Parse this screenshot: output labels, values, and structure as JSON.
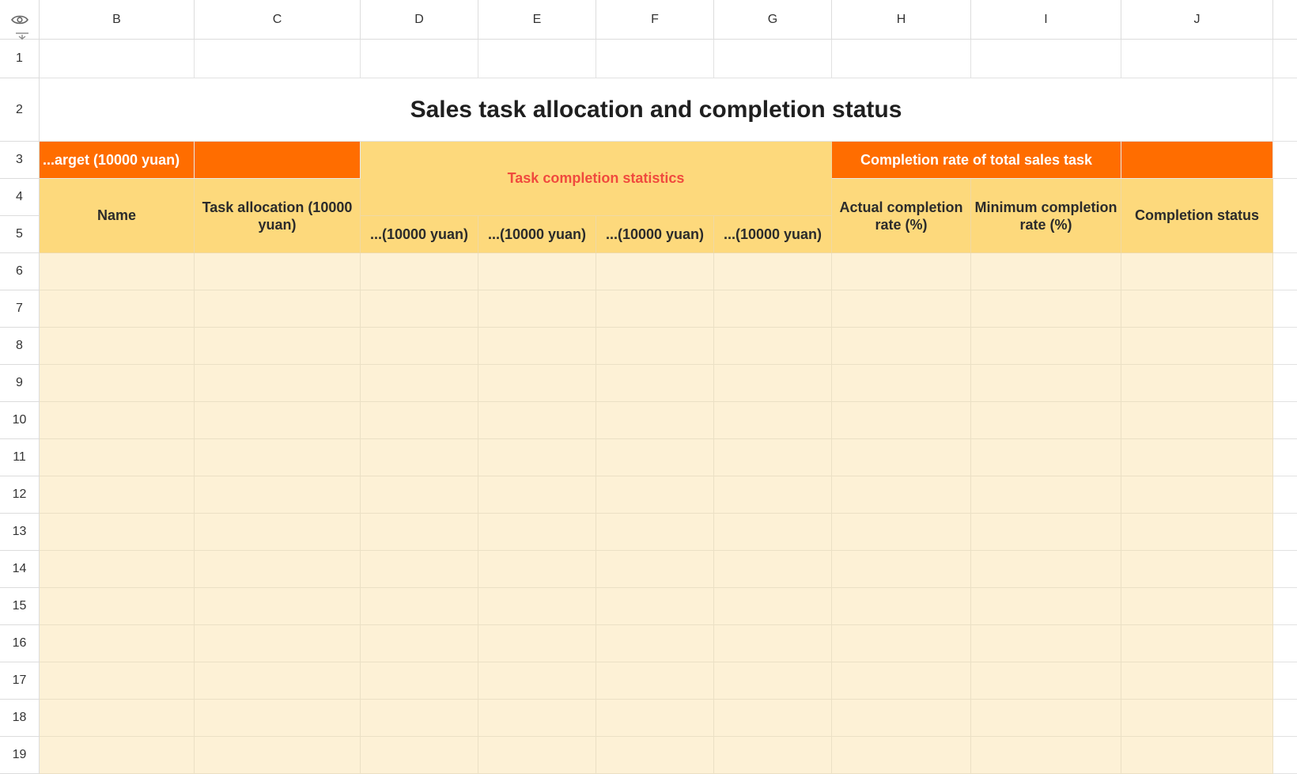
{
  "columns": [
    "B",
    "C",
    "D",
    "E",
    "F",
    "G",
    "H",
    "I",
    "J"
  ],
  "rows": [
    "1",
    "2",
    "3",
    "4",
    "5",
    "6",
    "7",
    "8",
    "9",
    "10",
    "11",
    "12",
    "13",
    "14",
    "15",
    "16",
    "17",
    "18",
    "19"
  ],
  "sheet": {
    "title": "Sales task allocation and completion status",
    "row3": {
      "target": "...arget (10000 yuan)",
      "completion_rate_total": "Completion rate of total sales task"
    },
    "stats_header": "Task completion statistics",
    "headers": {
      "name": "Name",
      "task_allocation": "Task allocation (10000 yuan)",
      "d": "...(10000 yuan)",
      "e": "...(10000 yuan)",
      "f": "...(10000 yuan)",
      "g": "...(10000 yuan)",
      "actual_rate": "Actual completion rate (%)",
      "minimum_rate": "Minimum completion rate (%)",
      "completion_status": "Completion status"
    }
  },
  "icons": {
    "corner_top": "eye-icon",
    "corner_bottom": "freeze-rows-icon"
  },
  "colors": {
    "orange": "#ff6d00",
    "header_yellow": "#fdd97c",
    "body_cream": "#fdf1d6",
    "stats_red": "#f04a3e"
  }
}
